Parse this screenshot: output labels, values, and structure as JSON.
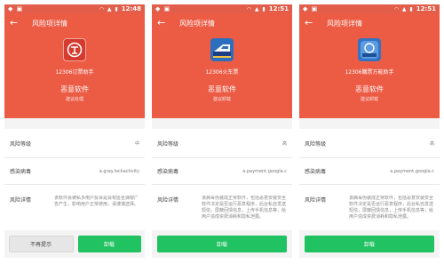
{
  "phones": [
    {
      "status_time": "12:48",
      "title": "风险项详情",
      "app_name": "12306订票助手",
      "risk_type": "恶意软件",
      "risk_advice": "建议处理",
      "level_label": "风险等级",
      "level_value": "中",
      "virus_label": "感染病毒",
      "virus_value": "a.gray.lockactivity",
      "detail_label": "风险详情",
      "detail_text": "该软件会被私多用户投诉是会有匿名弹窗广告产生，影响用户正常使用，请谨慎选择。",
      "ignore_button": "不再提示",
      "uninstall_button": "卸载",
      "icon": "railway-logo-icon"
    },
    {
      "status_time": "12:51",
      "title": "风险项详情",
      "app_name": "12306火车票",
      "risk_type": "恶意软件",
      "risk_advice": "建议卸载",
      "level_label": "风险等级",
      "level_value": "高",
      "virus_label": "感染病毒",
      "virus_value": "a.payment.googla.c",
      "detail_label": "风险详情",
      "detail_text": "该病毒伪装成正常软件，包括恶意安装安全软件决定是否运行恶意程序，后台私自发送短信，屏蔽回馈信息，上传手机信息等，给用户造成资费消耗和隐私泄露。",
      "uninstall_button": "卸载",
      "icon": "train-icon"
    },
    {
      "status_time": "12:51",
      "title": "风险项详情",
      "app_name": "12306購票万能助手",
      "risk_type": "恶意软件",
      "risk_advice": "建议卸载",
      "level_label": "风险等级",
      "level_value": "高",
      "virus_label": "感染病毒",
      "virus_value": "a.payment.googla.c",
      "detail_label": "风险详情",
      "detail_text": "该病毒伪装成正常软件，包括恶意安装安全软件决定是否运行恶意程序，后台私自发送短信，屏蔽回馈信息，上传手机信息等，给用户造成资费消耗和隐私泄露。",
      "uninstall_button": "卸载",
      "icon": "12306-helper-icon"
    }
  ],
  "colors": {
    "header": "#ec5b44",
    "statusbar": "#e35e4a",
    "primary_button": "#20c261"
  }
}
